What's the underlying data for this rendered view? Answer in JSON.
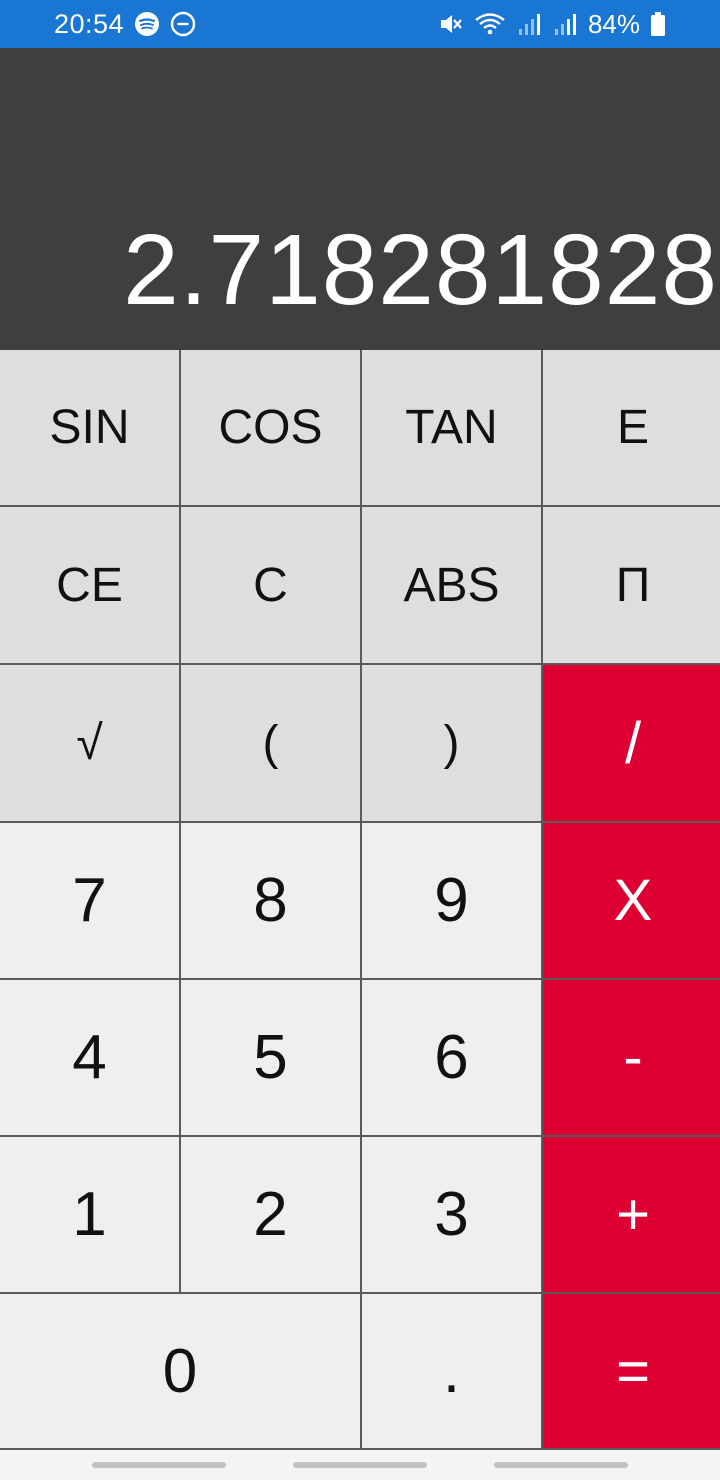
{
  "status_bar": {
    "time": "20:54",
    "battery_percent": "84%",
    "left_icons": [
      "spotify-icon",
      "do-not-disturb-icon"
    ],
    "right_icons": [
      "mute-icon",
      "wifi-icon",
      "signal-icon",
      "signal-icon",
      "battery-icon"
    ],
    "color": "#1976d2"
  },
  "display": {
    "value": "2.718281828"
  },
  "keypad": {
    "rows": [
      [
        "SIN",
        "COS",
        "TAN",
        "E"
      ],
      [
        "CE",
        "C",
        "ABS",
        "П"
      ],
      [
        "√",
        "(",
        ")",
        "/"
      ],
      [
        "7",
        "8",
        "9",
        "X"
      ],
      [
        "4",
        "5",
        "6",
        "-"
      ],
      [
        "1",
        "2",
        "3",
        "+"
      ],
      [
        "0",
        ".",
        "="
      ]
    ]
  },
  "colors": {
    "display_bg": "#3f3f3f",
    "function_key_bg": "#dedede",
    "number_key_bg": "#efefef",
    "operator_key_bg": "#de0032"
  }
}
